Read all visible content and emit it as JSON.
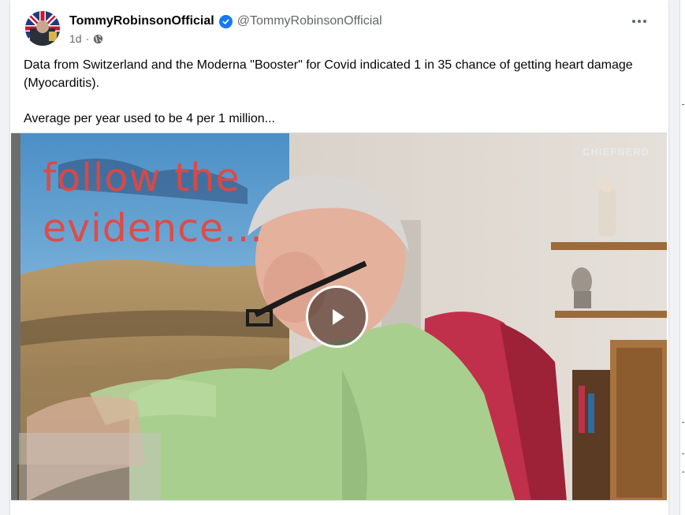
{
  "post": {
    "author_name": "TommyRobinsonOfficial",
    "author_handle": "@TommyRobinsonOfficial",
    "verified_icon": "verified-badge-icon",
    "timestamp": "1d",
    "separator": "·",
    "audience_icon": "globe-icon",
    "more_icon": "more-options-icon",
    "text_paragraphs": [
      "Data from Switzerland and the Moderna \"Booster\" for Covid indicated 1 in 35 chance of getting heart damage (Myocarditis).",
      "Average per year used to be 4 per 1 million..."
    ]
  },
  "video": {
    "watermark": "CHIEFNERD",
    "poster_line_1": "follow the",
    "poster_line_2": "evidence...",
    "play_icon": "play-icon",
    "colors": {
      "poster_text": "#e8453c",
      "shirt": "#a9cf8e",
      "chair": "#c0304a",
      "wall": "#ddd7cf"
    }
  },
  "colors": {
    "verified": "#1877f2",
    "secondary_text": "#65676b",
    "page_background": "#f0f2f5"
  }
}
